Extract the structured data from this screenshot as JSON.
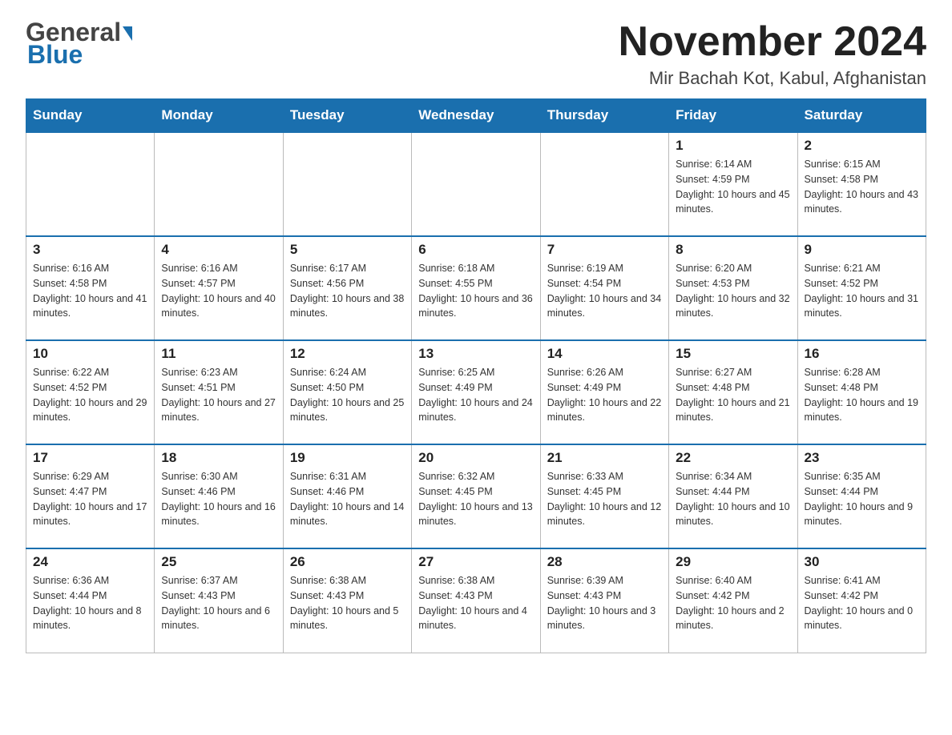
{
  "logo": {
    "line1": "General",
    "line2": "Blue"
  },
  "title": "November 2024",
  "subtitle": "Mir Bachah Kot, Kabul, Afghanistan",
  "days_of_week": [
    "Sunday",
    "Monday",
    "Tuesday",
    "Wednesday",
    "Thursday",
    "Friday",
    "Saturday"
  ],
  "weeks": [
    [
      {
        "day": "",
        "info": ""
      },
      {
        "day": "",
        "info": ""
      },
      {
        "day": "",
        "info": ""
      },
      {
        "day": "",
        "info": ""
      },
      {
        "day": "",
        "info": ""
      },
      {
        "day": "1",
        "info": "Sunrise: 6:14 AM\nSunset: 4:59 PM\nDaylight: 10 hours and 45 minutes."
      },
      {
        "day": "2",
        "info": "Sunrise: 6:15 AM\nSunset: 4:58 PM\nDaylight: 10 hours and 43 minutes."
      }
    ],
    [
      {
        "day": "3",
        "info": "Sunrise: 6:16 AM\nSunset: 4:58 PM\nDaylight: 10 hours and 41 minutes."
      },
      {
        "day": "4",
        "info": "Sunrise: 6:16 AM\nSunset: 4:57 PM\nDaylight: 10 hours and 40 minutes."
      },
      {
        "day": "5",
        "info": "Sunrise: 6:17 AM\nSunset: 4:56 PM\nDaylight: 10 hours and 38 minutes."
      },
      {
        "day": "6",
        "info": "Sunrise: 6:18 AM\nSunset: 4:55 PM\nDaylight: 10 hours and 36 minutes."
      },
      {
        "day": "7",
        "info": "Sunrise: 6:19 AM\nSunset: 4:54 PM\nDaylight: 10 hours and 34 minutes."
      },
      {
        "day": "8",
        "info": "Sunrise: 6:20 AM\nSunset: 4:53 PM\nDaylight: 10 hours and 32 minutes."
      },
      {
        "day": "9",
        "info": "Sunrise: 6:21 AM\nSunset: 4:52 PM\nDaylight: 10 hours and 31 minutes."
      }
    ],
    [
      {
        "day": "10",
        "info": "Sunrise: 6:22 AM\nSunset: 4:52 PM\nDaylight: 10 hours and 29 minutes."
      },
      {
        "day": "11",
        "info": "Sunrise: 6:23 AM\nSunset: 4:51 PM\nDaylight: 10 hours and 27 minutes."
      },
      {
        "day": "12",
        "info": "Sunrise: 6:24 AM\nSunset: 4:50 PM\nDaylight: 10 hours and 25 minutes."
      },
      {
        "day": "13",
        "info": "Sunrise: 6:25 AM\nSunset: 4:49 PM\nDaylight: 10 hours and 24 minutes."
      },
      {
        "day": "14",
        "info": "Sunrise: 6:26 AM\nSunset: 4:49 PM\nDaylight: 10 hours and 22 minutes."
      },
      {
        "day": "15",
        "info": "Sunrise: 6:27 AM\nSunset: 4:48 PM\nDaylight: 10 hours and 21 minutes."
      },
      {
        "day": "16",
        "info": "Sunrise: 6:28 AM\nSunset: 4:48 PM\nDaylight: 10 hours and 19 minutes."
      }
    ],
    [
      {
        "day": "17",
        "info": "Sunrise: 6:29 AM\nSunset: 4:47 PM\nDaylight: 10 hours and 17 minutes."
      },
      {
        "day": "18",
        "info": "Sunrise: 6:30 AM\nSunset: 4:46 PM\nDaylight: 10 hours and 16 minutes."
      },
      {
        "day": "19",
        "info": "Sunrise: 6:31 AM\nSunset: 4:46 PM\nDaylight: 10 hours and 14 minutes."
      },
      {
        "day": "20",
        "info": "Sunrise: 6:32 AM\nSunset: 4:45 PM\nDaylight: 10 hours and 13 minutes."
      },
      {
        "day": "21",
        "info": "Sunrise: 6:33 AM\nSunset: 4:45 PM\nDaylight: 10 hours and 12 minutes."
      },
      {
        "day": "22",
        "info": "Sunrise: 6:34 AM\nSunset: 4:44 PM\nDaylight: 10 hours and 10 minutes."
      },
      {
        "day": "23",
        "info": "Sunrise: 6:35 AM\nSunset: 4:44 PM\nDaylight: 10 hours and 9 minutes."
      }
    ],
    [
      {
        "day": "24",
        "info": "Sunrise: 6:36 AM\nSunset: 4:44 PM\nDaylight: 10 hours and 8 minutes."
      },
      {
        "day": "25",
        "info": "Sunrise: 6:37 AM\nSunset: 4:43 PM\nDaylight: 10 hours and 6 minutes."
      },
      {
        "day": "26",
        "info": "Sunrise: 6:38 AM\nSunset: 4:43 PM\nDaylight: 10 hours and 5 minutes."
      },
      {
        "day": "27",
        "info": "Sunrise: 6:38 AM\nSunset: 4:43 PM\nDaylight: 10 hours and 4 minutes."
      },
      {
        "day": "28",
        "info": "Sunrise: 6:39 AM\nSunset: 4:43 PM\nDaylight: 10 hours and 3 minutes."
      },
      {
        "day": "29",
        "info": "Sunrise: 6:40 AM\nSunset: 4:42 PM\nDaylight: 10 hours and 2 minutes."
      },
      {
        "day": "30",
        "info": "Sunrise: 6:41 AM\nSunset: 4:42 PM\nDaylight: 10 hours and 0 minutes."
      }
    ]
  ]
}
